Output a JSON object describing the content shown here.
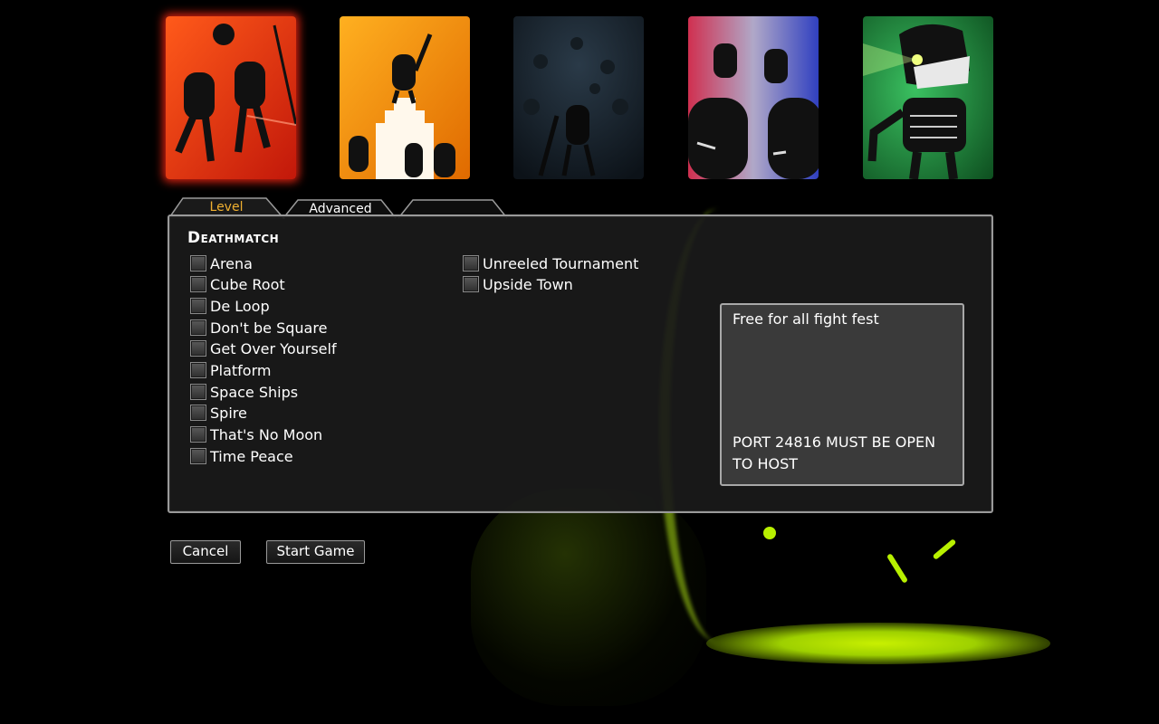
{
  "cards": [
    {
      "name": "deathmatch-card",
      "colors": [
        "#ff5a1a",
        "#c2180a"
      ],
      "selected": true
    },
    {
      "name": "tower-card",
      "colors": [
        "#ffb020",
        "#e06a00"
      ],
      "selected": false
    },
    {
      "name": "underwater-card",
      "colors": [
        "#2a3a48",
        "#0c1218"
      ],
      "selected": false
    },
    {
      "name": "team-card",
      "colors": [
        "#d03050",
        "#3040c0"
      ],
      "selected": false
    },
    {
      "name": "monster-card",
      "colors": [
        "#3ac060",
        "#0e5020"
      ],
      "selected": false
    }
  ],
  "tabs": {
    "level": "Level",
    "advanced": "Advanced",
    "third": ""
  },
  "section_title": "Deathmatch",
  "levels_col1": [
    "Arena",
    "Cube Root",
    "De Loop",
    "Don't be Square",
    "Get Over Yourself",
    "Platform",
    "Space Ships",
    "Spire",
    "That's No Moon",
    "Time Peace"
  ],
  "levels_col2": [
    "Unreeled Tournament",
    "Upside Town"
  ],
  "description": "Free for all fight fest",
  "port_notice": "PORT 24816 MUST BE OPEN TO HOST",
  "buttons": {
    "cancel": "Cancel",
    "start": "Start Game"
  },
  "colors": {
    "active_tab_text": "#f0b030",
    "glow": "#b8f000"
  }
}
